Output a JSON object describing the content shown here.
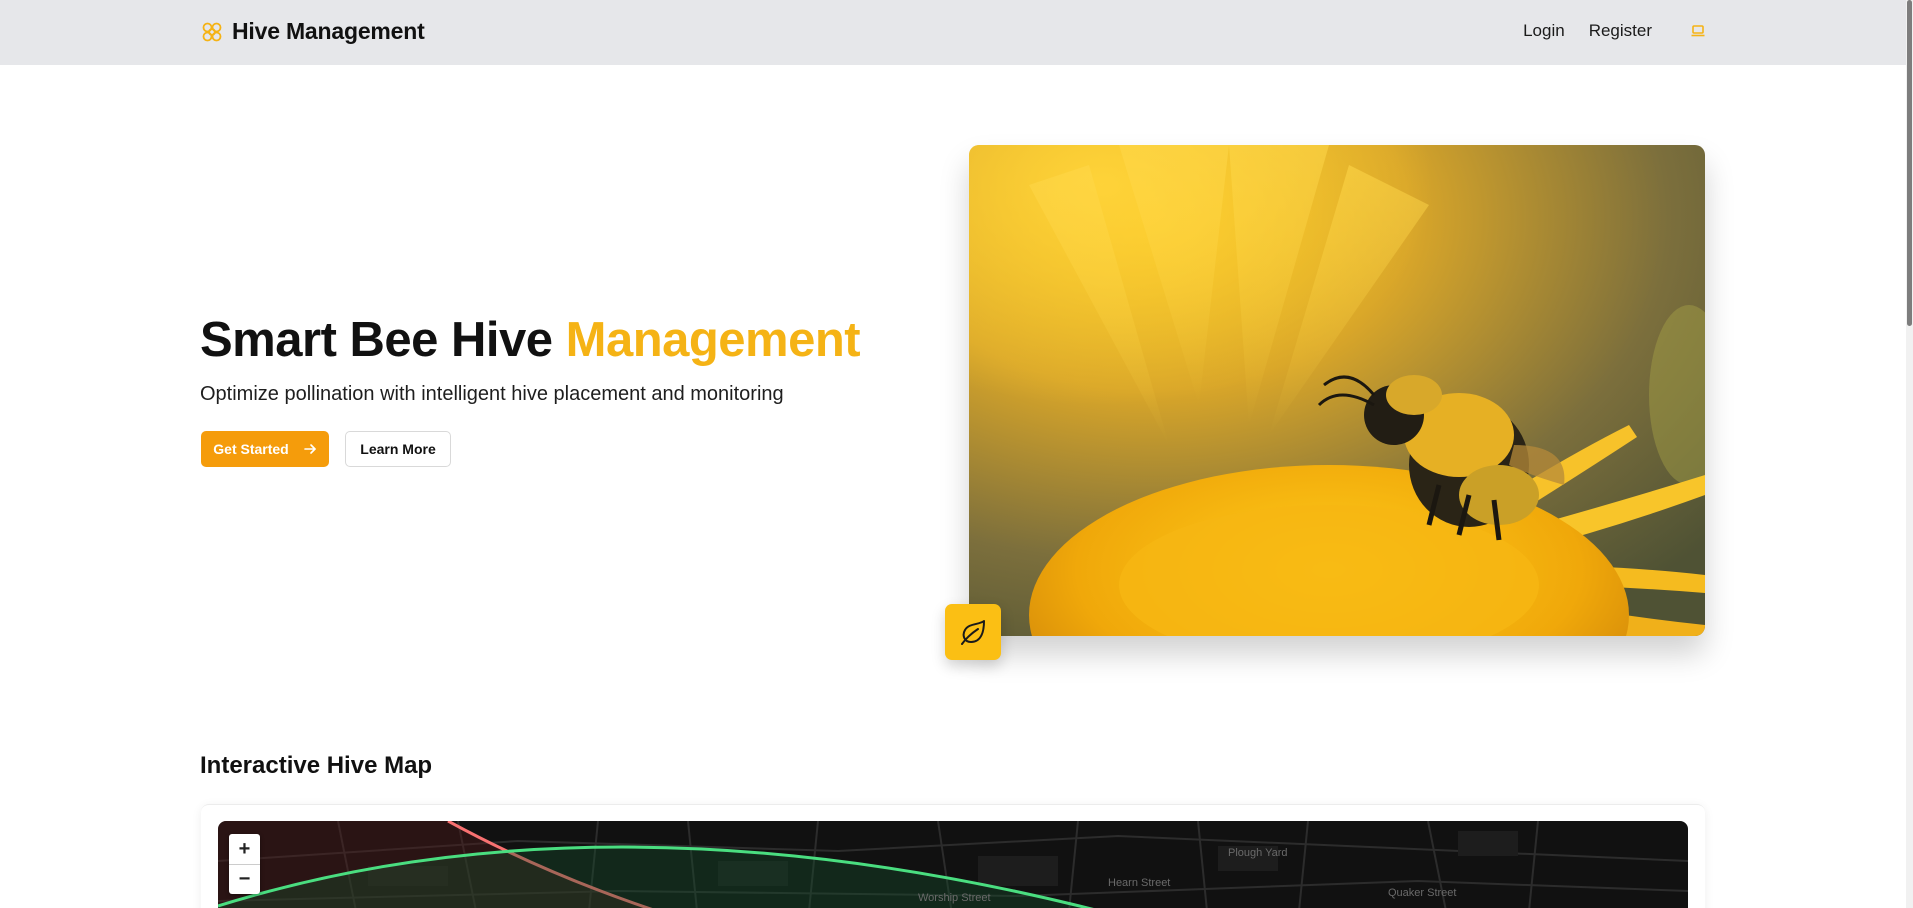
{
  "navbar": {
    "brand_name": "Hive Management",
    "brand_icon": "flower-icon",
    "links": {
      "login": "Login",
      "register": "Register"
    },
    "theme_toggle_icon": "laptop-icon",
    "accent_color": "#f5b315"
  },
  "hero": {
    "title_main": "Smart Bee Hive ",
    "title_accent": "Management",
    "subtitle": "Optimize pollination with intelligent hive placement and monitoring",
    "primary_button": {
      "label": "Get Started",
      "icon": "arrow-right-icon",
      "color": "#f59c0b"
    },
    "secondary_button": {
      "label": "Learn More"
    },
    "image": {
      "subject": "bee-on-yellow-flower-photo"
    },
    "badge_icon": "leaf-icon",
    "badge_color": "#fbbf14"
  },
  "map_section": {
    "title": "Interactive Hive Map",
    "zoom_in_label": "+",
    "zoom_out_label": "−",
    "street_labels": [
      "Worship Street",
      "Hearn Street",
      "Quaker Street",
      "Plough Yard"
    ],
    "zone_colors": {
      "good": "#4ade80",
      "bad": "#f87171"
    }
  }
}
